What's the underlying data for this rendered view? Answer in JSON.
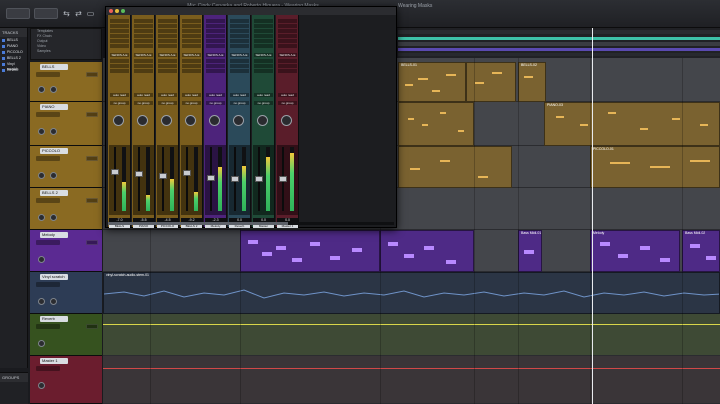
{
  "window_title": "Mix: Cindy Cervarka and Roberto Higuera - Wearing Masks",
  "edit_window_title": "Wearing Masks",
  "tracks_panel": {
    "header": "TRACKS",
    "items": [
      "BELLS",
      "PIANO",
      "PICCOLO",
      "BELLS 2",
      "Vinyl scratch",
      "Reverb"
    ]
  },
  "groups_label": "GROUPS",
  "clip_list": [
    "Templates",
    "FX Chain",
    "Output",
    "Video",
    "Samples"
  ],
  "tracks": [
    {
      "name": "BELLS",
      "color": "#8a6a22"
    },
    {
      "name": "PIANO",
      "color": "#8a6a22"
    },
    {
      "name": "PICCOLO",
      "color": "#8a6a22"
    },
    {
      "name": "BELLS 2",
      "color": "#8a6a22"
    },
    {
      "name": "Melody",
      "color": "#5b2a92"
    },
    {
      "name": "Vinyl scratch",
      "color": "#2d3c55"
    },
    {
      "name": "Reverb",
      "color": "#36521f"
    },
    {
      "name": "Master 1",
      "color": "#6b1d2e"
    }
  ],
  "clip_labels": {
    "bells_a": "BELLS-01",
    "bells_b": "BELLS-02",
    "piano_a": "PIANO-03",
    "piccolo_a": "PICCOLO-01",
    "melody_a": "Bass Midi-01",
    "melody_b": "Bass Midi-02",
    "melody_c": "Melody",
    "vinyl": "vinyl-scratch-audio-stem-01"
  },
  "mixer": {
    "strips": [
      {
        "name": "BELLS",
        "color": "#7a5d1d",
        "value": "-7.0",
        "level": 0.45,
        "fader": 0.62
      },
      {
        "name": "PIANO",
        "color": "#7a5d1d",
        "value": "-5.5",
        "level": 0.25,
        "fader": 0.58
      },
      {
        "name": "PICCOLO",
        "color": "#7a5d1d",
        "value": "-4.5",
        "level": 0.5,
        "fader": 0.55
      },
      {
        "name": "BELLS 2",
        "color": "#7a5d1d",
        "value": "-9.2",
        "level": 0.3,
        "fader": 0.6
      },
      {
        "name": "Melody",
        "color": "#4d237b",
        "value": "-2.3",
        "level": 0.68,
        "fader": 0.52
      },
      {
        "name": "Reverb",
        "color": "#2b4a5a",
        "value": "0.0",
        "level": 0.7,
        "fader": 0.5
      },
      {
        "name": "Master",
        "color": "#1f4a37",
        "value": "0.0",
        "level": 0.85,
        "fader": 0.5
      },
      {
        "name": "Master 1",
        "color": "#5a1d2a",
        "value": "0.0",
        "level": 0.9,
        "fader": 0.5
      }
    ],
    "auto_label": "auto read",
    "send_label": "SENDS A-E",
    "no_group": "no group"
  },
  "colors": {
    "gold": "#8a6a22",
    "purple": "#6a35b0",
    "blue": "#2c3f5e",
    "accent": "#3ec1a8"
  }
}
